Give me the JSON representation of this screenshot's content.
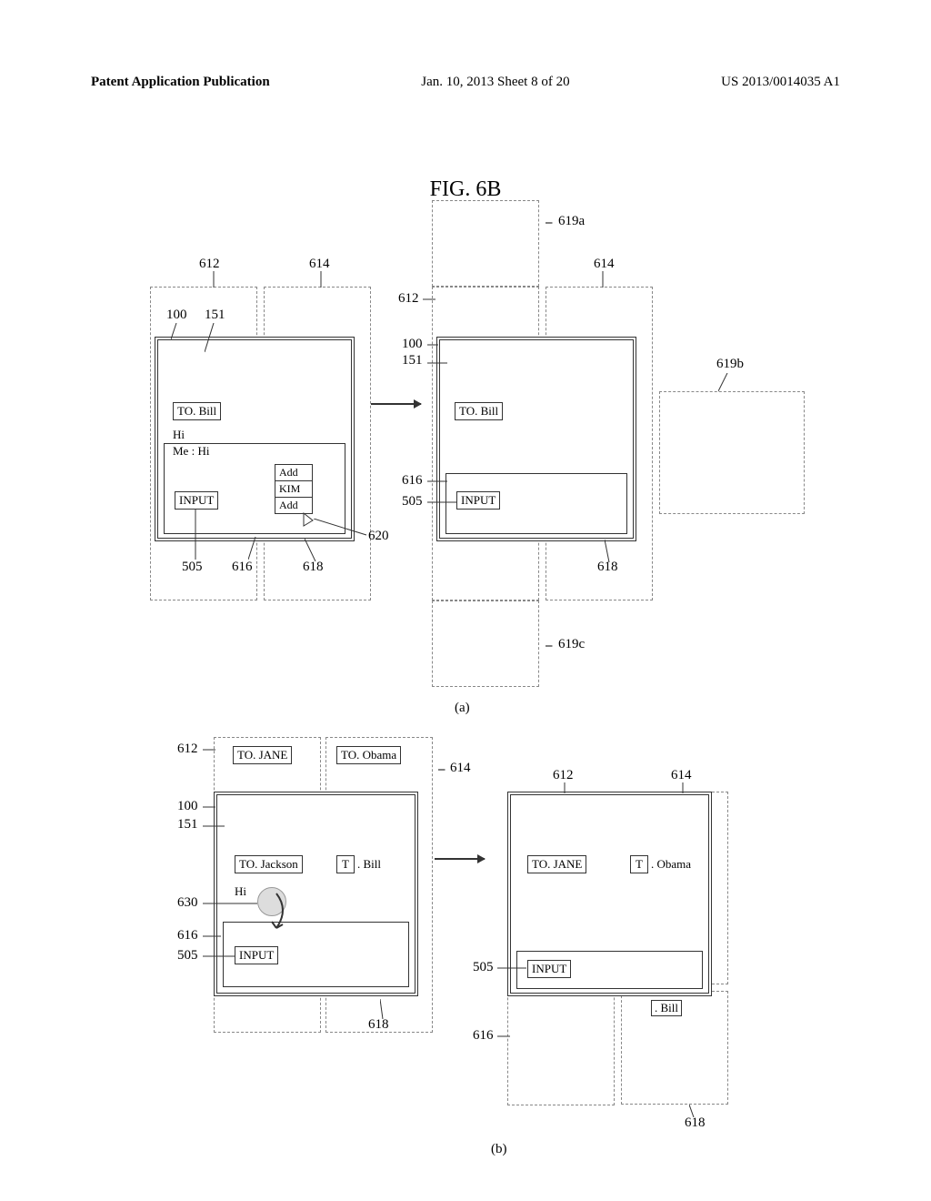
{
  "header": {
    "left": "Patent Application Publication",
    "center": "Jan. 10, 2013  Sheet 8 of 20",
    "right": "US 2013/0014035 A1"
  },
  "figure_title": "FIG. 6B",
  "labels": {
    "n100": "100",
    "n151": "151",
    "n505": "505",
    "n612": "612",
    "n614": "614",
    "n616": "616",
    "n618": "618",
    "n619a": "619a",
    "n619b": "619b",
    "n619c": "619c",
    "n620": "620",
    "n630": "630"
  },
  "content": {
    "to_bill": "TO. Bill",
    "to_jane": "TO. JANE",
    "to_obama": "TO. Obama",
    "to_jackson": "TO. Jackson",
    "t_box": "T",
    "dot_bill": ". Bill",
    "dot_obama": ". Obama",
    "hi": "Hi",
    "me_hi": "Me : Hi",
    "input": "INPUT",
    "add": "Add",
    "kim": "KIM"
  },
  "sub": {
    "a": "(a)",
    "b": "(b)"
  }
}
